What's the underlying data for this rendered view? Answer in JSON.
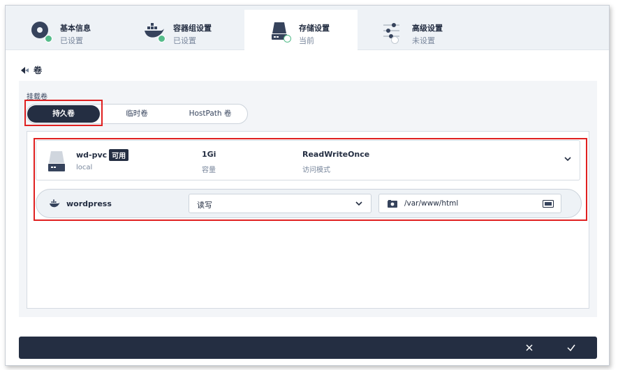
{
  "steps": [
    {
      "title": "基本信息",
      "status": "已设置",
      "icon": "info-disc-icon"
    },
    {
      "title": "容器组设置",
      "status": "已设置",
      "icon": "docker-icon"
    },
    {
      "title": "存储设置",
      "status": "当前",
      "icon": "storage-disk-icon"
    },
    {
      "title": "高级设置",
      "status": "未设置",
      "icon": "sliders-icon"
    }
  ],
  "header": {
    "back_title": "卷"
  },
  "volume": {
    "mount_label": "挂载卷",
    "tabs": [
      "持久卷",
      "临时卷",
      "HostPath 卷"
    ],
    "active_tab": "持久卷"
  },
  "pvc": {
    "name": "wd-pvc",
    "badge": "可用",
    "storage_class": "local",
    "capacity": "1Gi",
    "capacity_label": "容量",
    "access_mode": "ReadWriteOnce",
    "access_mode_label": "访问模式"
  },
  "mount": {
    "container": "wordpress",
    "mode": "读写",
    "path": "/var/www/html"
  },
  "colors": {
    "accent": "#242e42",
    "success": "#55bc8a",
    "highlight": "#e02020",
    "panel": "#f3f5f8"
  }
}
